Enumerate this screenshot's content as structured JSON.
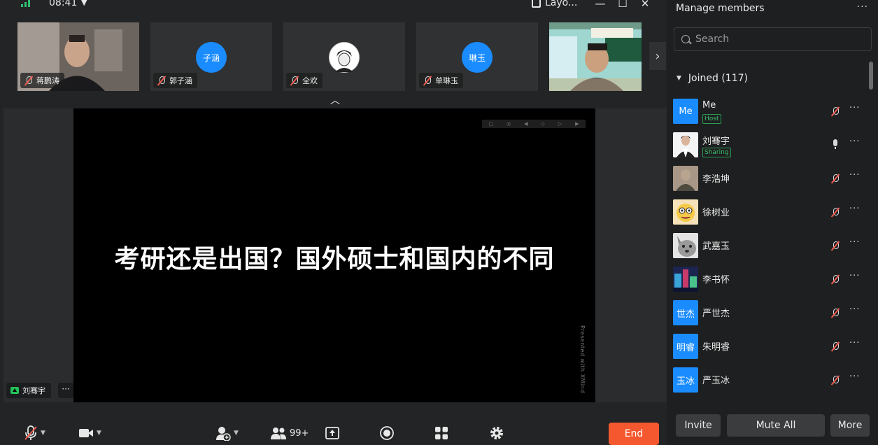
{
  "top_bar": {
    "time": "08:41",
    "layout_label": "Layo..."
  },
  "thumbnails": [
    {
      "name": "蒋鹏涛",
      "avatar_text": ""
    },
    {
      "name": "郭子涵",
      "avatar_text": "子涵"
    },
    {
      "name": "全欢",
      "avatar_text": ""
    },
    {
      "name": "单琳玉",
      "avatar_text": "琳玉"
    },
    {
      "name": "",
      "avatar_text": ""
    }
  ],
  "stage": {
    "slide_title": "考研还是出国？国外硕士和国内的不同",
    "watermark": "Presented with XMind",
    "sharer_name": "刘骞宇",
    "sharer_more": "···"
  },
  "toolbar": {
    "participants_count": "99+",
    "end_label": "End"
  },
  "sidebar": {
    "title": "Manage members",
    "more": "···",
    "search_placeholder": "Search",
    "joined_label": "Joined (117)",
    "members": [
      {
        "name": "Me",
        "avatar_text": "Me",
        "badge": "Host",
        "mic": "muted"
      },
      {
        "name": "刘骞宇",
        "avatar_text": "",
        "badge": "Sharing",
        "mic": "on"
      },
      {
        "name": "李浩坤",
        "avatar_text": "",
        "badge": "",
        "mic": "muted"
      },
      {
        "name": "徐树业",
        "avatar_text": "",
        "badge": "",
        "mic": "muted"
      },
      {
        "name": "武嘉玉",
        "avatar_text": "",
        "badge": "",
        "mic": "muted"
      },
      {
        "name": "李书怀",
        "avatar_text": "",
        "badge": "",
        "mic": "muted"
      },
      {
        "name": "严世杰",
        "avatar_text": "世杰",
        "badge": "",
        "mic": "muted"
      },
      {
        "name": "朱明睿",
        "avatar_text": "明睿",
        "badge": "",
        "mic": "muted"
      },
      {
        "name": "严玉冰",
        "avatar_text": "玉冰",
        "badge": "",
        "mic": "muted"
      }
    ],
    "invite_label": "Invite",
    "mute_all_label": "Mute All",
    "more_label": "More"
  },
  "colors": {
    "accent_blue": "#1a8cff",
    "end_red": "#f5582e",
    "badge_green": "#3cc06b",
    "mute_red": "#f05b4f"
  }
}
